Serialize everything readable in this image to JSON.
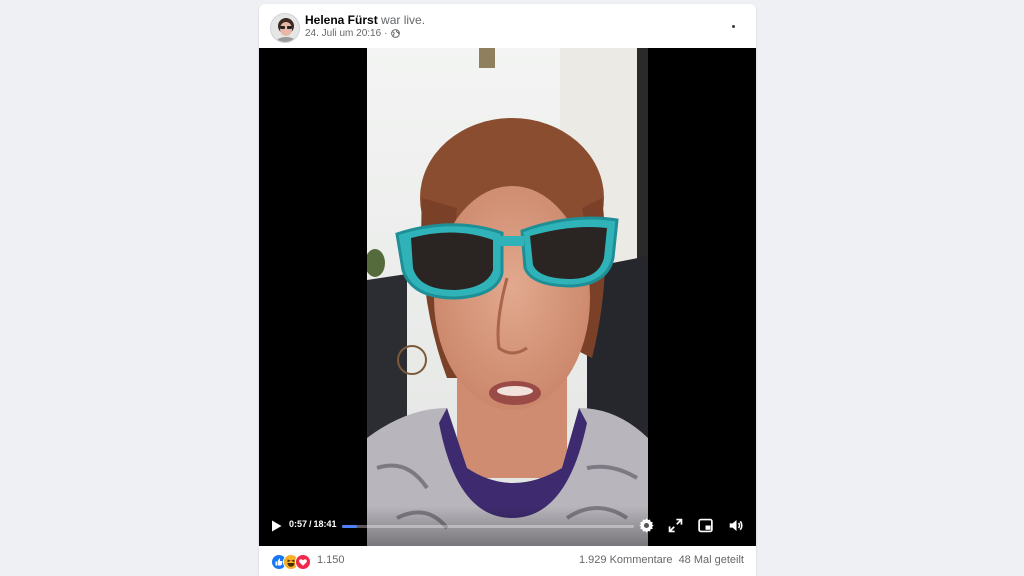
{
  "post": {
    "author": "Helena Fürst",
    "action": "war live.",
    "date": "24. Juli um 20:16",
    "meta_separator": "·",
    "privacy_icon": "globe-icon",
    "menu_icon": "more-options-icon"
  },
  "video": {
    "current_time": "0:57",
    "time_separator": "/",
    "duration": "18:41",
    "progress_fraction": 0.051,
    "accent_color": "#4f81ff",
    "controls": [
      "play-icon",
      "settings-icon",
      "fullscreen-icon",
      "picture-in-picture-icon",
      "volume-icon"
    ]
  },
  "footer": {
    "reactions": [
      "like-icon",
      "haha-icon",
      "love-icon"
    ],
    "reaction_count": "1.150",
    "comments": "1.929 Kommentare",
    "shares": "48 Mal geteilt"
  }
}
